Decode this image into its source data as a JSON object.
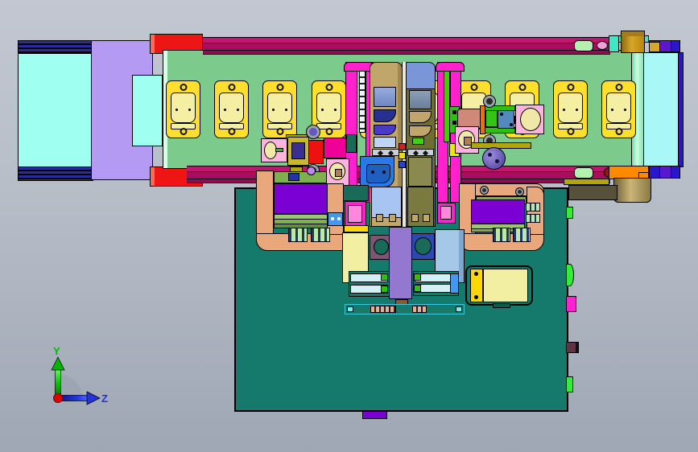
{
  "viewport_kind": "cad-front-view",
  "axis_triad": {
    "y_label": "Y",
    "z_label": "Z"
  },
  "conveyor": {
    "pallet_count": 10,
    "pallet_positions": [
      206,
      266,
      326,
      387,
      447,
      507,
      567,
      627,
      687,
      747
    ]
  },
  "palette": {
    "bgTop": "#C2C7D1",
    "bgBottom": "#9FA6B4",
    "railA": "#C01570",
    "railB": "#A80D5F",
    "railC": "#8E0D52",
    "redCap": "#EE1515",
    "redCapHi": "#FF6A5A",
    "feederBlue": "#2B2B9E",
    "feederBody": "#B49AF2",
    "feederCyan": "#9FFFF0",
    "bedGreen": "#7CCB8C",
    "bedEdge": "#D9FFE9",
    "mintRoller": "#9BEFC6",
    "outfeedCyan": "#A9F7F7",
    "barBlue": "#2A17CC",
    "barPurple": "#5A17CC",
    "tealBracket": "#3FE8C4",
    "gold": "#D7A62B",
    "goldDark": "#A67C1A",
    "brassDark": "#6E6237",
    "brassLight": "#CBB477",
    "brassMid": "#8A7A46",
    "oliveBlock": "#57513C",
    "orange": "#FF8A00",
    "oliveBar": "#B2A513",
    "baseTeal": "#157A6B",
    "peach": "#E8A87C",
    "purpleRect": "#7A00D4",
    "deckGreen": "#7FAF4F",
    "deckGreenHi": "#9CC86A",
    "deckGreenLo": "#5F8F3F",
    "combPale": "#BCE8A8",
    "combSlot": "#223366",
    "towerTan": "#C0A66B",
    "towerTanDk": "#A08850",
    "towerOlive": "#6E6E30",
    "towerBlueTop": "#7B96D8",
    "winBlueA": "#97ACDE",
    "winBlueB": "#6F87C2",
    "winGrayA": "#8C9FB8",
    "winGrayB": "#6B7E98",
    "navy": "#26308F",
    "indigo": "#4A3ACB",
    "paleBlue": "#BFD4F2",
    "diamondBg": "#C9CFD8",
    "brightBlue": "#2979E8",
    "brightBlueDk": "#1E5FC0",
    "panelBlue": "#A8C4F0",
    "rtPanelLow": "#8A8A50",
    "rtPanelFeet": "#7A7A40",
    "midStrip": "#E8E8DC",
    "magenta": "#FF22CC",
    "pinkInner": "#FF88DD",
    "lime": "#44CC00",
    "limeBlob": "#33EE33",
    "pinkPanel": "#FFB3DE",
    "circlePale": "#F0E8A8",
    "redBlock": "#EE1111",
    "navySquare": "#3A2F90",
    "magentaBlock": "#EE0099",
    "salmon": "#D08878",
    "orangeBar": "#FF6A00",
    "greenBright": "#2FBF10",
    "greenSq": "#35C315",
    "steelBlue": "#5588BB",
    "rodGray": "#9AA2B2",
    "screwGray": "#98A0AA",
    "motorBlob": "#6656C0",
    "oliveBlockSm": "#C8B830",
    "tealDark": "#1A6A5A",
    "blueConn": "#4499EE",
    "yellow": "#FFD700",
    "paleYellow": "#F2EFA2",
    "mauve": "#7D5575",
    "navySq2": "#2B49B0",
    "pillarPurple": "#9477CE",
    "brown": "#8B5A2B",
    "slabBlue": "#A6C8E8",
    "slabBlueDk": "#7FA8D0",
    "cylCyan": "#D5F0F4",
    "railStripCyan": "#40C8D8",
    "peachSeg": "#E8B088",
    "maroonKnob": "#5E3344",
    "plateYellow": "#FFDF2E",
    "plateInner": "#F5EFA4",
    "axisGreen": "#00C800",
    "axisBlue": "#2233DD",
    "axisRed": "#E00000",
    "axisLabelY": "#00BB00",
    "axisLabelZ": "#2233DD",
    "arcGray": "#98A1AD"
  }
}
